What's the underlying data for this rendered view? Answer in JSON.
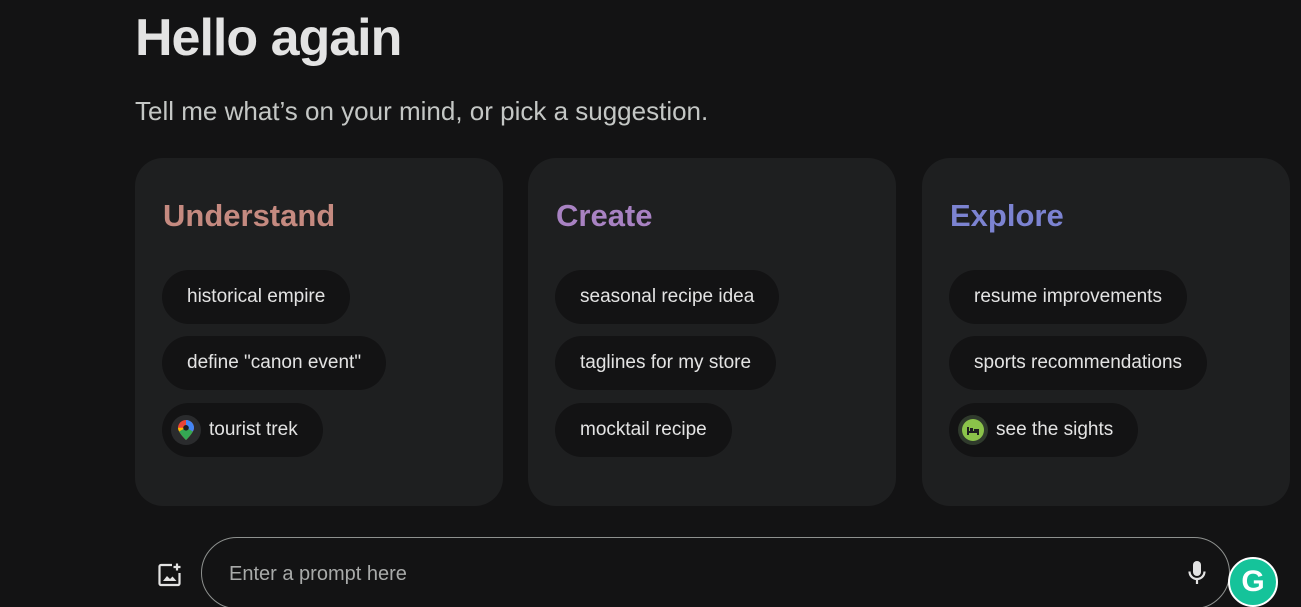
{
  "greeting": "Hello again",
  "subtitle": "Tell me what’s on your mind, or pick a suggestion.",
  "colors": {
    "understand": "#c58a80",
    "create": "#a882c2",
    "explore": "#7c83d1"
  },
  "cards": [
    {
      "title": "Understand",
      "chips": [
        {
          "label": "historical empire"
        },
        {
          "label": "define \"canon event\""
        },
        {
          "label": "tourist trek",
          "icon": "google-maps-pin-icon"
        }
      ]
    },
    {
      "title": "Create",
      "chips": [
        {
          "label": "seasonal recipe idea"
        },
        {
          "label": "taglines for my store"
        },
        {
          "label": "mocktail recipe"
        }
      ]
    },
    {
      "title": "Explore",
      "chips": [
        {
          "label": "resume improvements"
        },
        {
          "label": "sports recommendations"
        },
        {
          "label": "see the sights",
          "icon": "hotel-bed-icon"
        }
      ]
    }
  ],
  "prompt": {
    "placeholder": "Enter a prompt here",
    "add_image_icon": "add-image-icon",
    "mic_icon": "microphone-icon"
  },
  "grammarly": {
    "letter": "G"
  }
}
